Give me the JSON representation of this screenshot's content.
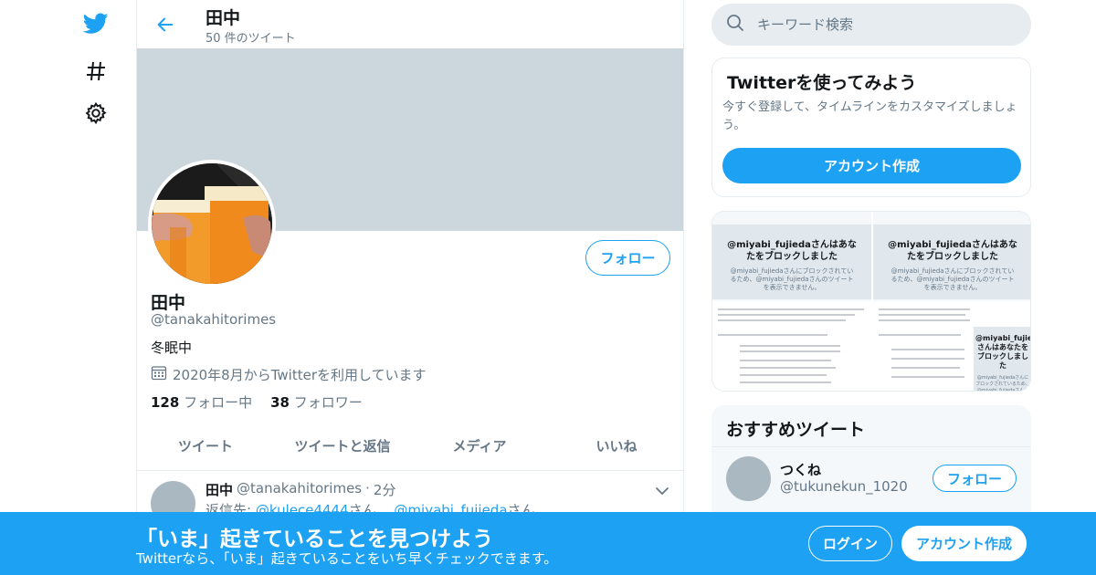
{
  "colors": {
    "accent": "#1da1f2",
    "secondary_text": "#657786",
    "banner": "#ccd6dd",
    "border": "#e6ecf0"
  },
  "nav": {
    "icons": [
      "twitter-logo",
      "hashtag-icon",
      "gear-icon"
    ]
  },
  "header": {
    "title": "田中",
    "subtitle": "50 件のツイート"
  },
  "profile": {
    "name": "田中",
    "handle": "@tanakahitorimes",
    "bio": "冬眠中",
    "joined": "2020年8月からTwitterを利用しています",
    "following_count": "128",
    "following_label": "フォロー中",
    "followers_count": "38",
    "followers_label": "フォロワー",
    "follow_label": "フォロー"
  },
  "tabs": [
    "ツイート",
    "ツイートと返信",
    "メディア",
    "いいね"
  ],
  "tweet": {
    "author": "田中",
    "handle": "@tanakahitorimes",
    "dot": "·",
    "time": "2分",
    "reply_prefix": "返信先:",
    "reply_user1": "@kulece4444",
    "reply_mid": "さん、",
    "reply_user2": "@miyabi_fujieda",
    "reply_suffix": "さん"
  },
  "search": {
    "placeholder": "キーワード検索"
  },
  "signup_card": {
    "title": "Twitterを使ってみよう",
    "text": "今すぐ登録して、タイムラインをカスタマイズしましょう。",
    "button": "アカウント作成"
  },
  "media": {
    "block_title": "@miyabi_fujiedaさんはあなたをブロックしました",
    "block_sub": "@miyabi_fujiedaさんにブロックされているため、@miyabi_fujiedaさんのツイートを表示できません。"
  },
  "recommend": {
    "title": "おすすめツイート",
    "name": "つくね",
    "handle": "@tukunekun_1020",
    "follow_label": "フォロー"
  },
  "bottom_bar": {
    "title": "「いま」起きていることを見つけよう",
    "subtitle": "Twitterなら、「いま」起きていることをいち早くチェックできます。",
    "login": "ログイン",
    "signup": "アカウント作成"
  }
}
